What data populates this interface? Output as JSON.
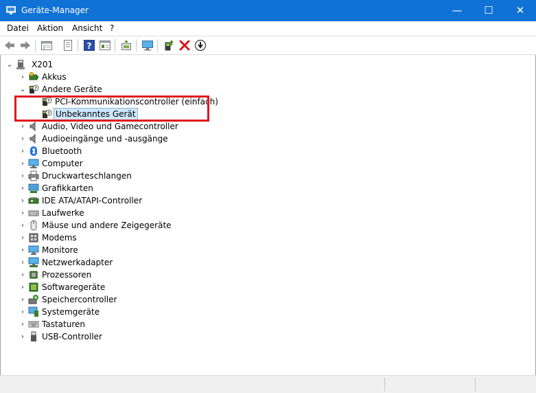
{
  "window": {
    "title": "Geräte-Manager",
    "minimize_glyph": "—",
    "maximize_glyph": "☐",
    "close_glyph": "✕"
  },
  "menu": {
    "items": [
      "Datei",
      "Aktion",
      "Ansicht",
      "?"
    ]
  },
  "toolbar": {
    "icons": [
      "back-arrow-icon",
      "forward-arrow-icon",
      "view-list-icon",
      "properties-icon",
      "help-icon",
      "view-details-icon",
      "scan-hardware-icon",
      "monitor-icon",
      "add-driver-icon",
      "uninstall-x-icon",
      "disable-device-icon"
    ]
  },
  "tree": {
    "root": "X201",
    "categories": [
      {
        "label": "Akkus",
        "icon": "battery-icon",
        "expanded": false
      },
      {
        "label": "Andere Geräte",
        "icon": "unknown-device-icon",
        "expanded": true,
        "children": [
          {
            "label": "PCI-Kommunikationscontroller (einfach)",
            "icon": "unknown-device-icon"
          },
          {
            "label": "Unbekanntes Gerät",
            "icon": "unknown-device-icon",
            "selected": true
          }
        ]
      },
      {
        "label": "Audio, Video und Gamecontroller",
        "icon": "speaker-icon"
      },
      {
        "label": "Audioeingänge und -ausgänge",
        "icon": "speaker-icon"
      },
      {
        "label": "Bluetooth",
        "icon": "bluetooth-icon"
      },
      {
        "label": "Computer",
        "icon": "computer-icon"
      },
      {
        "label": "Druckwarteschlangen",
        "icon": "printer-icon"
      },
      {
        "label": "Grafikkarten",
        "icon": "display-adapter-icon"
      },
      {
        "label": "IDE ATA/ATAPI-Controller",
        "icon": "ide-controller-icon"
      },
      {
        "label": "Laufwerke",
        "icon": "disk-drive-icon"
      },
      {
        "label": "Mäuse und andere Zeigegeräte",
        "icon": "mouse-icon"
      },
      {
        "label": "Modems",
        "icon": "modem-icon"
      },
      {
        "label": "Monitore",
        "icon": "monitor-icon"
      },
      {
        "label": "Netzwerkadapter",
        "icon": "network-adapter-icon"
      },
      {
        "label": "Prozessoren",
        "icon": "processor-icon"
      },
      {
        "label": "Softwaregeräte",
        "icon": "software-device-icon"
      },
      {
        "label": "Speichercontroller",
        "icon": "storage-controller-icon"
      },
      {
        "label": "Systemgeräte",
        "icon": "system-device-icon"
      },
      {
        "label": "Tastaturen",
        "icon": "keyboard-icon"
      },
      {
        "label": "USB-Controller",
        "icon": "usb-icon"
      }
    ]
  },
  "colors": {
    "titlebar": "#1172d6",
    "highlight_box": "#e0161d",
    "selection": "#cce8ff"
  }
}
